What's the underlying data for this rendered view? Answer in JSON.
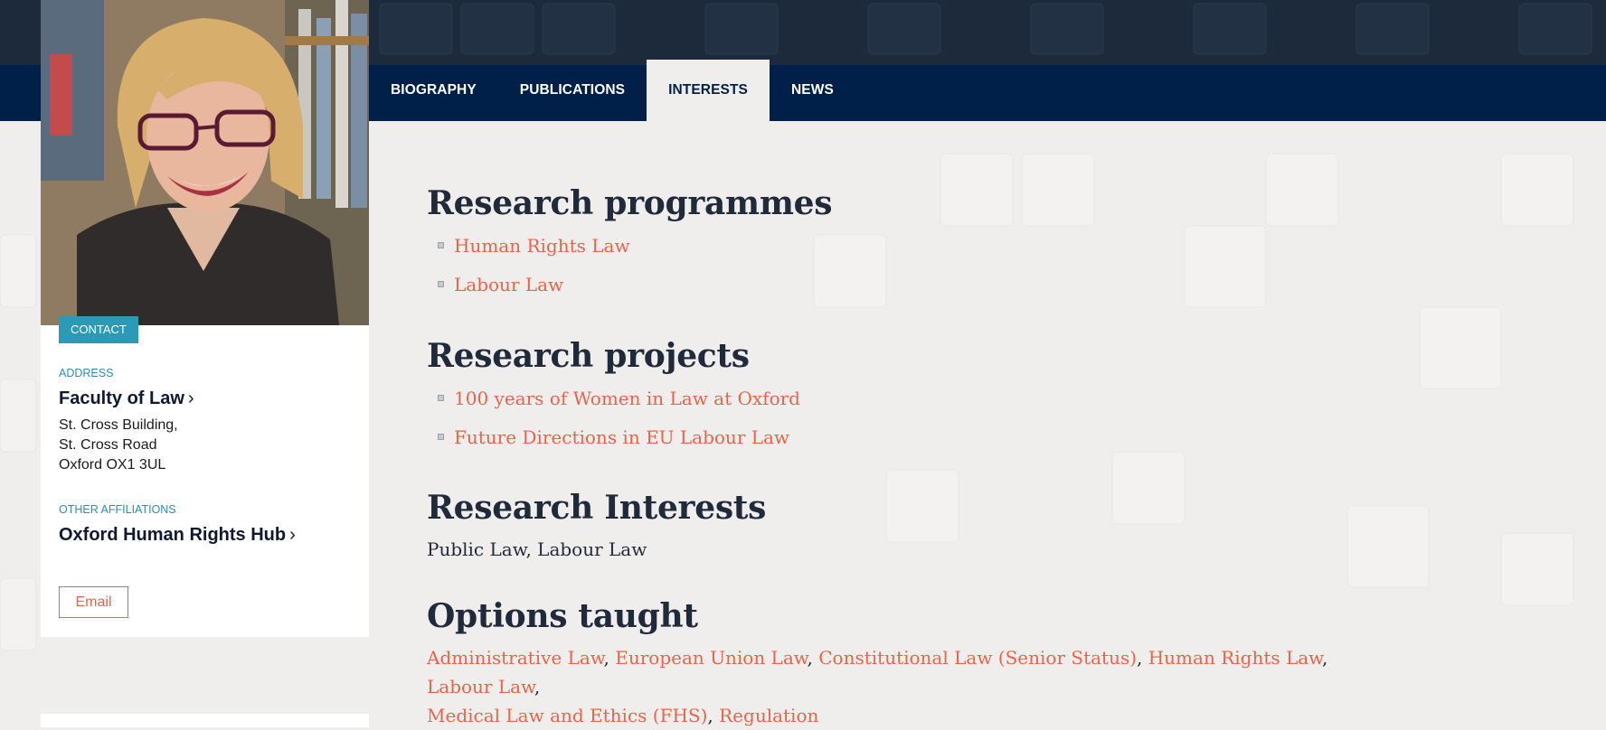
{
  "nav": {
    "tabs": [
      {
        "label": "BIOGRAPHY",
        "active": false
      },
      {
        "label": "PUBLICATIONS",
        "active": false
      },
      {
        "label": "INTERESTS",
        "active": true
      },
      {
        "label": "NEWS",
        "active": false
      }
    ]
  },
  "sidebar": {
    "contact_label": "CONTACT",
    "address_label": "ADDRESS",
    "faculty_link": "Faculty of Law",
    "address_lines": [
      "St. Cross Building,",
      "St. Cross Road",
      "Oxford OX1 3UL"
    ],
    "affiliations_label": "OTHER AFFILIATIONS",
    "affiliation_link": "Oxford Human Rights Hub",
    "email_button": "Email"
  },
  "main": {
    "research_programmes": {
      "heading": "Research programmes",
      "items": [
        "Human Rights Law",
        "Labour Law"
      ]
    },
    "research_projects": {
      "heading": "Research projects",
      "items": [
        "100 years of Women in Law at Oxford",
        "Future Directions in EU Labour Law"
      ]
    },
    "research_interests": {
      "heading": "Research Interests",
      "text": "Public Law, Labour Law"
    },
    "options_taught": {
      "heading": "Options taught",
      "items": [
        "Administrative Law",
        "European Union Law",
        "Constitutional Law (Senior Status)",
        "Human Rights Law",
        "Labour Law",
        "Medical Law and Ethics (FHS)",
        "Regulation"
      ]
    }
  },
  "colors": {
    "nav_bg": "#00204a",
    "top_bg": "#1c2a3b",
    "link": "#e8644a",
    "heading": "#1f2a3a",
    "contact_badge": "#2a9ab7"
  }
}
